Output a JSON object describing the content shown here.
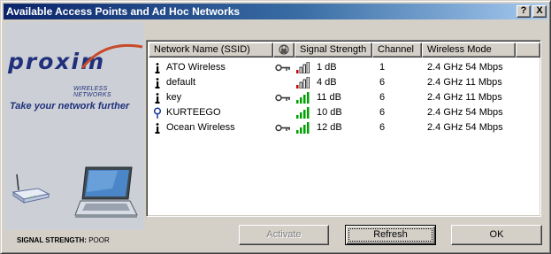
{
  "window": {
    "title": "Available Access Points and Ad Hoc Networks",
    "help_glyph": "?",
    "close_glyph": "X"
  },
  "branding": {
    "logo": "proxim",
    "subtitle": "WIRELESS NETWORKS",
    "tagline": "Take your network further",
    "signal_label": "SIGNAL STRENGTH:",
    "signal_value": "POOR"
  },
  "table": {
    "columns": {
      "name": "Network Name (SSID)",
      "key": "",
      "signal": "Signal Strength",
      "channel": "Channel",
      "mode": "Wireless Mode"
    },
    "rows": [
      {
        "ssid": "ATO Wireless",
        "type": "access-point",
        "encrypted": true,
        "bars": 1,
        "signal": "1 dB",
        "channel": "1",
        "mode": "2.4 GHz 54 Mbps"
      },
      {
        "ssid": "default",
        "type": "access-point",
        "encrypted": false,
        "bars": 1,
        "signal": "4 dB",
        "channel": "6",
        "mode": "2.4 GHz 11 Mbps"
      },
      {
        "ssid": "key",
        "type": "access-point",
        "encrypted": true,
        "bars": 4,
        "signal": "11 dB",
        "channel": "6",
        "mode": "2.4 GHz 11 Mbps"
      },
      {
        "ssid": "KURTEEGO",
        "type": "ad-hoc",
        "encrypted": false,
        "bars": 4,
        "signal": "10 dB",
        "channel": "6",
        "mode": "2.4 GHz 54 Mbps"
      },
      {
        "ssid": "Ocean Wireless",
        "type": "access-point",
        "encrypted": true,
        "bars": 4,
        "signal": "12 dB",
        "channel": "6",
        "mode": "2.4 GHz 54 Mbps"
      }
    ]
  },
  "buttons": {
    "activate": "Activate",
    "refresh": "Refresh",
    "ok": "OK"
  },
  "colors": {
    "title_bar_start": "#0a246a",
    "title_bar_end": "#a6caf0",
    "brand_blue": "#20307a",
    "bar_red": "#cc0000",
    "bar_green": "#00a000"
  },
  "icons": {
    "help": "help-icon",
    "close": "close-icon",
    "access_point": "antenna-icon",
    "ad_hoc": "ad-hoc-icon",
    "encryption": "key-icon",
    "signal": "signal-bars-icon",
    "router": "router-icon",
    "laptop": "laptop-icon"
  }
}
